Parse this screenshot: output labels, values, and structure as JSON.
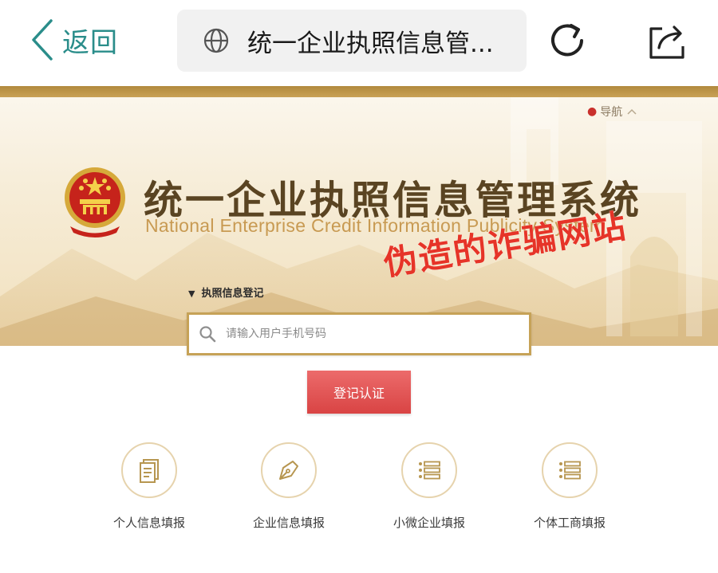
{
  "browser": {
    "back_label": "返回",
    "url_text": "统一企业执照信息管...",
    "icons": [
      "back-chevron-icon",
      "globe-icon",
      "reload-icon",
      "share-icon"
    ]
  },
  "hero": {
    "nav_label": "导航",
    "title_cn": "统一企业执照信息管理系统",
    "title_en": "National Enterprise Credit Information Publicity System",
    "section_label": "执照信息登记",
    "warning_stamp": "伪造的诈骗网站"
  },
  "form": {
    "phone_placeholder": "请输入用户手机号码",
    "submit_label": "登记认证"
  },
  "entries": [
    {
      "label": "个人信息填报",
      "icon": "document-icon"
    },
    {
      "label": "企业信息填报",
      "icon": "pen-icon"
    },
    {
      "label": "小微企业填报",
      "icon": "list-icon"
    },
    {
      "label": "个体工商填报",
      "icon": "list-icon"
    }
  ],
  "colors": {
    "accent_teal": "#2a8d8a",
    "gold": "#c6a257",
    "submit_red": "#d94444",
    "stamp_red": "#e63428"
  }
}
